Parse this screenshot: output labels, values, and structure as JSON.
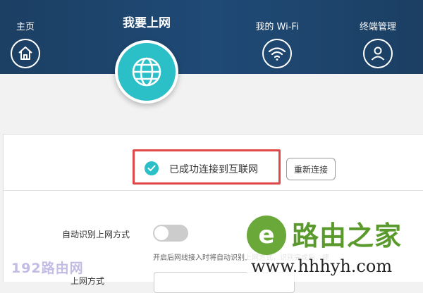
{
  "nav": {
    "home_label": "主页",
    "active_label": "我要上网",
    "wifi_label": "我的 Wi-Fi",
    "terminal_label": "终端管理"
  },
  "status": {
    "connected_text": "已成功连接到互联网",
    "reconnect_label": "重新连接"
  },
  "settings": {
    "auto_detect_label": "自动识别上网方式",
    "auto_detect_enabled": false,
    "hint_text": "开启后网线接入时将自动识别上网方式，识别完成后，建议关闭。",
    "next_label": "上网方式"
  },
  "watermarks": {
    "left_text": "192路由网",
    "right_title": "路由之家",
    "right_url": "www.hhhyh.com",
    "logo_glyph": "e"
  },
  "colors": {
    "topbar": "#1f4a76",
    "accent": "#2bbfc8",
    "highlight_border": "#e04848"
  },
  "icons": [
    "home-icon",
    "globe-icon",
    "wifi-icon",
    "user-icon",
    "check-icon"
  ]
}
